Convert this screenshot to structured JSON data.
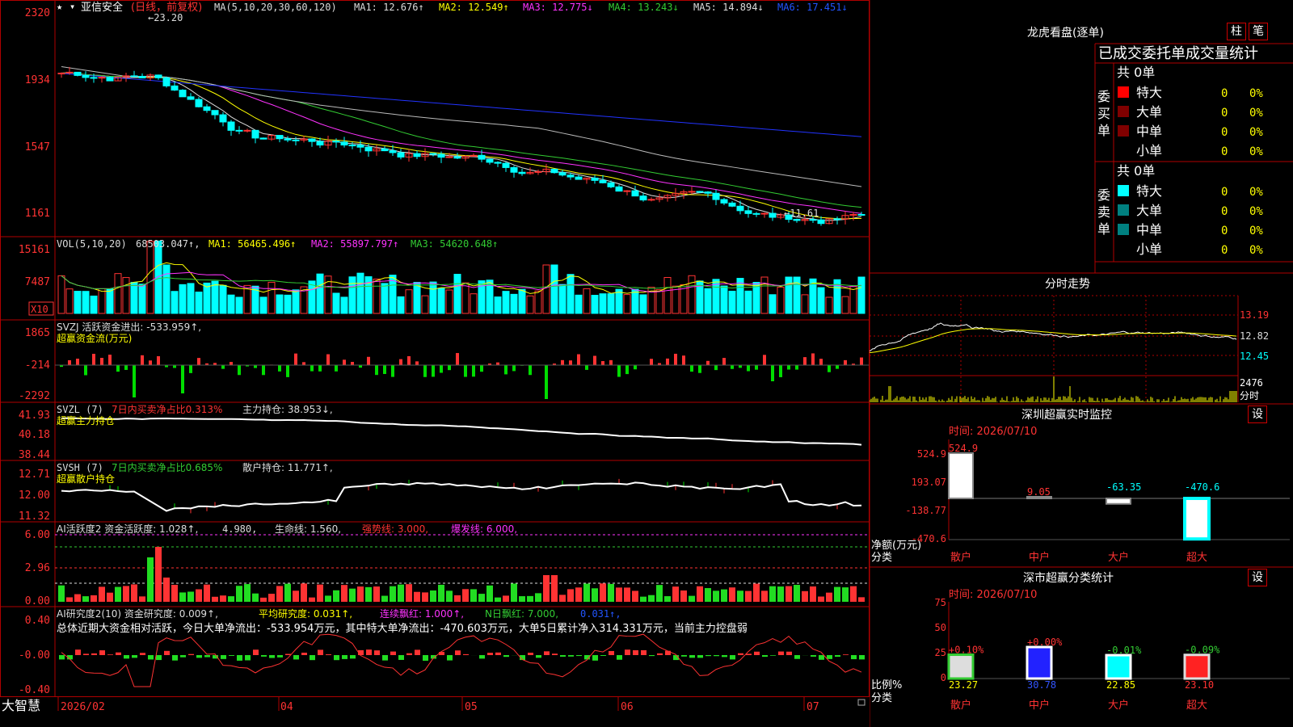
{
  "app": {
    "brand": "大智慧"
  },
  "colors": {
    "up": "#ff3333",
    "down": "#00ffff",
    "grid": "#b00000",
    "yellow": "#ffff00",
    "magenta": "#ff33ff",
    "green": "#33cc33",
    "white": "#dddddd",
    "blue": "#2233ff"
  },
  "kline": {
    "title": "亚信安全",
    "period": "(日线，前复权)",
    "ma_label": "MA(5,10,20,30,60,120)",
    "ma1": "MA1: 12.676↑",
    "ma2": "MA2: 12.549↑",
    "ma3": "MA3: 12.775↓",
    "ma4": "MA4: 13.243↓",
    "ma5": "MA5: 14.894↓",
    "ma6": "MA6: 17.451↓",
    "y_ticks": [
      "2320",
      "1934",
      "1547",
      "1161"
    ],
    "high_note": "←23.20",
    "low_note": "←11.61"
  },
  "vol": {
    "label": "VOL(5,10,20)",
    "val": "68503.047↑,",
    "ma1": "MA1: 56465.496↑",
    "ma2": "MA2: 55897.797↑",
    "ma3": "MA3: 54620.648↑",
    "y_ticks": [
      "15161",
      "7487"
    ],
    "unit": "X10"
  },
  "svzj": {
    "label": "SVZJ  活跃资金进出: -533.959↑,",
    "sub": "超赢资金流(万元)",
    "y_ticks": [
      "1865",
      "-214",
      "-2292"
    ]
  },
  "svzl": {
    "label": "SVZL (7)",
    "pct": "7日内买卖净占比0.313%",
    "hold": "主力持仓: 38.953↓,",
    "sub": "超赢主力持仓",
    "y_ticks": [
      "41.93",
      "40.18",
      "38.44"
    ]
  },
  "svsh": {
    "label": "SVSH (7)",
    "pct": "7日内买卖净占比0.685%",
    "hold": "散户持仓: 11.771↑,",
    "sub": "超赢散户持仓",
    "y_ticks": [
      "12.71",
      "12.00",
      "11.32"
    ]
  },
  "ai1": {
    "label": "AI活跃度2 资金活跃度: 1.028↑,",
    "v2": "4.980,",
    "life": "生命线: 1.560,",
    "strong": "强势线: 3.000,",
    "burst": "爆发线: 6.000,",
    "y_ticks": [
      "6.00",
      "2.96",
      "0.00"
    ]
  },
  "ai2": {
    "label": "AI研究度2(10) 资金研究度: 0.009↑,",
    "avg": "平均研究度: 0.031↑,",
    "red": "连续飘红: 1.000↑,",
    "nred": "N日飘红: 7.000,",
    "v5": "0.031↑,",
    "summary": "总体近期大资金相对活跃，今日大单净流出：-533.954万元，其中特大单净流出：-470.603万元，大单5日累计净入314.331万元，当前主力控盘弱",
    "y_ticks": [
      "0.40",
      "-0.00",
      "-0.40"
    ]
  },
  "x_axis": [
    "2026/02",
    "04",
    "05",
    "06",
    "07"
  ],
  "lhb": {
    "title": "龙虎看盘(逐单)",
    "btn1": "柱",
    "btn2": "笔",
    "header": "已成交委托单成交量统计",
    "buy": {
      "side": "委买单",
      "total": "共 0单",
      "rows": [
        {
          "name": "特大",
          "n": "0",
          "p": "0%"
        },
        {
          "name": "大单",
          "n": "0",
          "p": "0%"
        },
        {
          "name": "中单",
          "n": "0",
          "p": "0%"
        },
        {
          "name": "小单",
          "n": "0",
          "p": "0%"
        }
      ]
    },
    "sell": {
      "side": "委卖单",
      "total": "共 0单",
      "rows": [
        {
          "name": "特大",
          "n": "0",
          "p": "0%"
        },
        {
          "name": "大单",
          "n": "0",
          "p": "0%"
        },
        {
          "name": "中单",
          "n": "0",
          "p": "0%"
        },
        {
          "name": "小单",
          "n": "0",
          "p": "0%"
        }
      ]
    }
  },
  "intraday": {
    "title": "分时走势",
    "y": [
      "13.19",
      "12.82",
      "12.45"
    ],
    "vol": "2476",
    "vol_label": "分时"
  },
  "monitor": {
    "title": "深圳超赢实时监控",
    "btn": "设",
    "time": "时间: 2026/07/10",
    "y": [
      "524.9",
      "193.07",
      "-138.77",
      "-470.6"
    ],
    "cats": [
      "散户",
      "中户",
      "大户",
      "超大"
    ],
    "values": [
      524.9,
      9.05,
      -63.35,
      -470.6
    ],
    "value_labels": [
      "524.9",
      "9.05",
      "-63.35",
      "-470.6"
    ],
    "ylabel": "净额(万元)",
    "xlabel": "分类"
  },
  "classify": {
    "title": "深市超赢分类统计",
    "btn": "设",
    "time": "时间: 2026/07/10",
    "y": [
      "75",
      "50",
      "25",
      "0"
    ],
    "cats": [
      "散户",
      "中户",
      "大户",
      "超大"
    ],
    "values": [
      23.27,
      30.78,
      22.85,
      23.1
    ],
    "value_labels": [
      "23.27",
      "30.78",
      "22.85",
      "23.10"
    ],
    "changes": [
      "+0.10%",
      "+0.00%",
      "-0.01%",
      "-0.09%"
    ],
    "ylabel": "比例%",
    "xlabel": "分类"
  }
}
